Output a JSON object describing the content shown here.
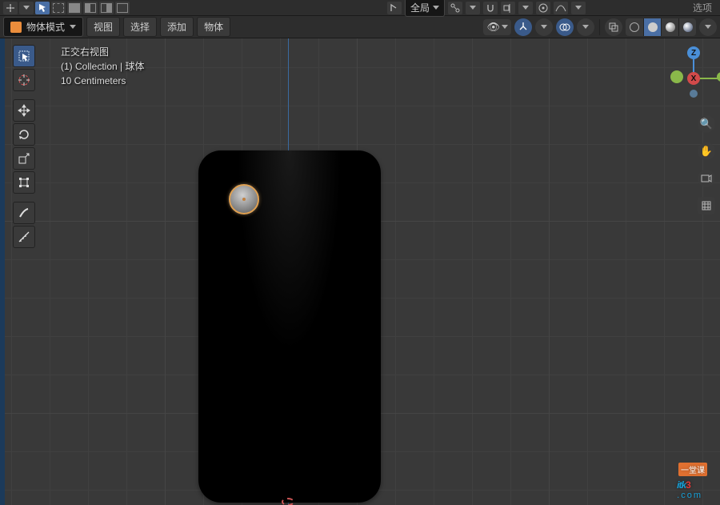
{
  "toolbar1": {
    "orientation_label": "全局",
    "options_label": "选项"
  },
  "toolbar2": {
    "mode_label": "物体模式",
    "menu_view": "视图",
    "menu_select": "选择",
    "menu_add": "添加",
    "menu_object": "物体"
  },
  "overlay": {
    "view_name": "正交右视图",
    "collection_line": "(1) Collection | 球体",
    "scale_line": "10 Centimeters"
  },
  "gizmo": {
    "z": "Z",
    "x": "X"
  },
  "icons": {
    "snap": "snap-icon",
    "cursor": "cursor-icon",
    "select_box": "select-box-icon",
    "overlap_a": "overlap-a-icon",
    "overlap_b": "overlap-b-icon",
    "overlap_c": "overlap-c-icon",
    "proportional": "proportional-icon"
  },
  "watermark": {
    "brand_a": "itk",
    "brand_b": "3",
    "brand_c": ".com",
    "tag": "一堂课"
  }
}
